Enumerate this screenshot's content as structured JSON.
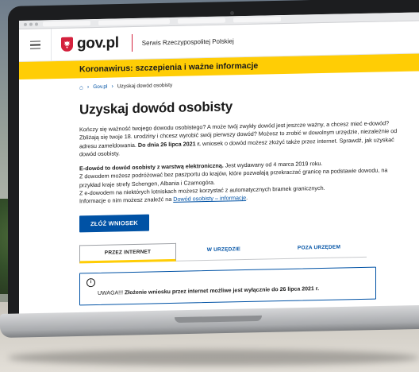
{
  "header": {
    "logo_text": "gov.pl",
    "tagline": "Serwis Rzeczypospolitej Polskiej"
  },
  "banner": {
    "text": "Koronawirus: szczepienia i ważne informacje"
  },
  "breadcrumb": {
    "home_icon": "home-icon",
    "items": [
      "Gov.pl",
      "Uzyskaj dowód osobisty"
    ]
  },
  "page": {
    "title": "Uzyskaj dowód osobisty",
    "intro": "Kończy się ważność twojego dowodu osobistego? A może twój zwykły dowód jest jeszcze ważny, a chcesz mieć e-dowód? Zbliżają się twoje 18. urodziny i chcesz wyrobić swój pierwszy dowód? Możesz to zrobić w dowolnym urzędzie, niezależnie od adresu zameldowania. ",
    "intro_bold": "Do dnia 26 lipca 2021 r.",
    "intro_end": " wniosek o dowód możesz złożyć także przez internet. Sprawdź, jak uzyskać dowód osobisty.",
    "p2_bold": "E-dowód to dowód osobisty z warstwą elektroniczną.",
    "p2_line1": " Jest wydawany od 4 marca 2019 roku.",
    "p2_line2": "Z dowodem możesz podróżować bez paszportu do krajów, które pozwalają przekraczać granicę na podstawie dowodu, na przykład kraje strefy Schengen, Albania i Czarnogóra.",
    "p2_line3": "Z e-dowodem na niektórych lotniskach możesz korzystać z automatycznych bramek granicznych.",
    "p2_line4": "Informacje o nim możesz znaleźć na ",
    "p2_link": "Dowód osobisty – informacje",
    "p2_end": "."
  },
  "cta": {
    "label": "ZŁÓŻ WNIOSEK"
  },
  "tabs": [
    {
      "label": "PRZEZ INTERNET",
      "active": true
    },
    {
      "label": "W URZĘDZIE",
      "active": false
    },
    {
      "label": "POZA URZĘDEM",
      "active": false
    }
  ],
  "alert": {
    "icon": "info-icon",
    "prefix": "UWAGA!!! ",
    "text_bold": "Złożenie wniosku przez internet możliwe jest wyłącznie do 26 lipca 2021 r."
  },
  "colors": {
    "accent": "#0052a5",
    "banner": "#ffcd05",
    "brand_red": "#d4213d"
  }
}
